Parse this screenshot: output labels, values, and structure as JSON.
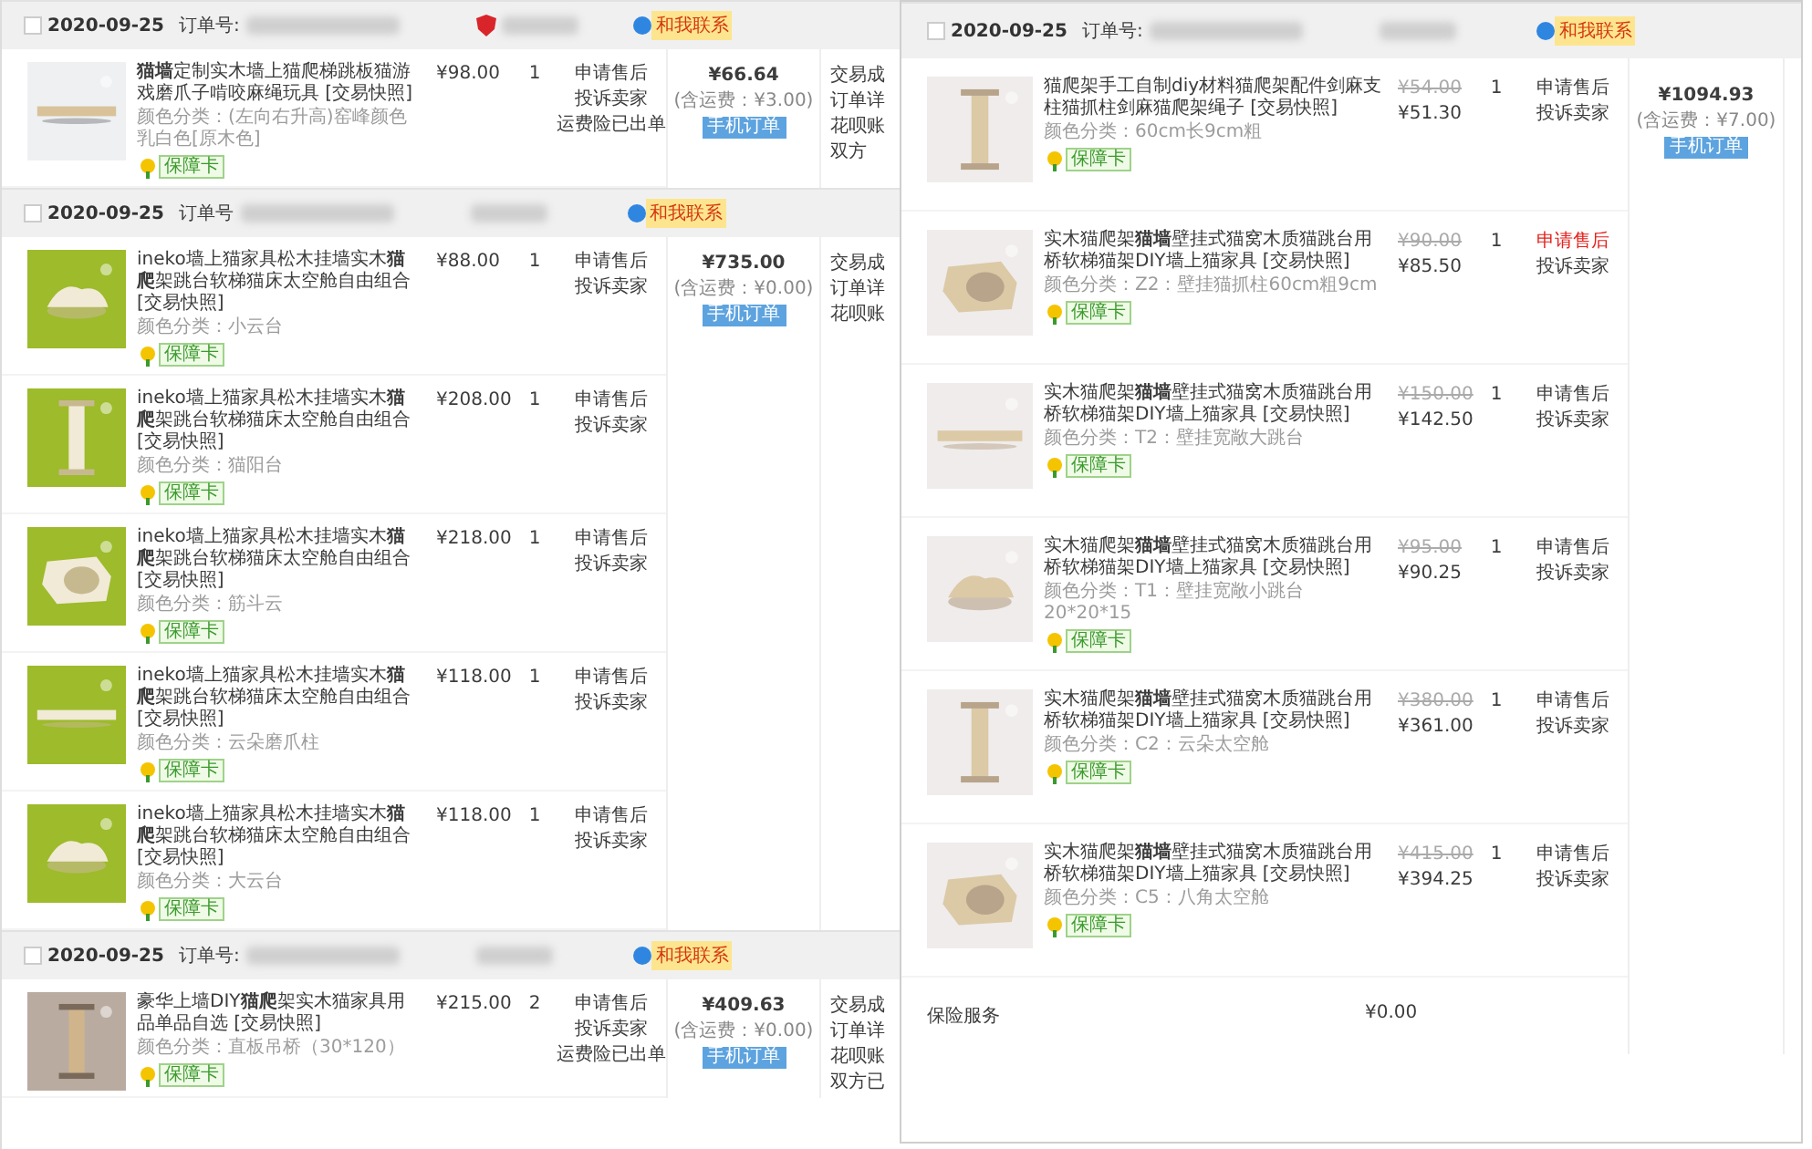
{
  "left_panel": {
    "orders": [
      {
        "checked": false,
        "date": "2020-09-25",
        "order_label": "订单号:",
        "shield_icon": true,
        "contact_badge": "和我联系",
        "total": "¥66.64",
        "shipping_note": "(含运费：¥3.00)",
        "mobile_badge": "手机订单",
        "status_lines": [
          "交易成",
          "订单详",
          "花呗账",
          "双方"
        ],
        "items": [
          {
            "kind": "picture",
            "title": "**猫墙**定制实木墙上猫爬梯跳板猫游戏磨爪子啃咬麻绳玩具 [交易快照]",
            "variant": "颜色分类：(左向右升高)窑峰颜色乳白色[原木色]",
            "badge": "保障卡",
            "price": "¥98.00",
            "quantity": "1",
            "actions": [
              {
                "label": "申请售后",
                "alert": false
              },
              {
                "label": "投诉卖家",
                "alert": false
              },
              {
                "label": "运费险已出单",
                "alert": false
              }
            ]
          }
        ]
      },
      {
        "checked": false,
        "date": "2020-09-25",
        "order_label": "订单号",
        "shield_icon": false,
        "contact_badge": "和我联系",
        "total": "¥735.00",
        "shipping_note": "(含运费：¥0.00)",
        "mobile_badge": "手机订单",
        "status_lines": [
          "交易成",
          "订单详",
          "花呗账"
        ],
        "items": [
          {
            "kind": "picture",
            "title": "ineko墙上猫家具松木挂墙实木**猫爬**架跳台软梯猫床太空舱自由组合 [交易快照]",
            "variant": "颜色分类：小云台",
            "badge": "保障卡",
            "price": "¥88.00",
            "quantity": "1",
            "actions": [
              {
                "label": "申请售后",
                "alert": false
              },
              {
                "label": "投诉卖家",
                "alert": false
              }
            ]
          },
          {
            "kind": "picture",
            "title": "ineko墙上猫家具松木挂墙实木**猫爬**架跳台软梯猫床太空舱自由组合 [交易快照]",
            "variant": "颜色分类：猫阳台",
            "badge": "保障卡",
            "price": "¥208.00",
            "quantity": "1",
            "actions": [
              {
                "label": "申请售后",
                "alert": false
              },
              {
                "label": "投诉卖家",
                "alert": false
              }
            ]
          },
          {
            "kind": "picture",
            "title": "ineko墙上猫家具松木挂墙实木**猫爬**架跳台软梯猫床太空舱自由组合 [交易快照]",
            "variant": "颜色分类：筋斗云",
            "badge": "保障卡",
            "price": "¥218.00",
            "quantity": "1",
            "actions": [
              {
                "label": "申请售后",
                "alert": false
              },
              {
                "label": "投诉卖家",
                "alert": false
              }
            ]
          },
          {
            "kind": "picture",
            "title": "ineko墙上猫家具松木挂墙实木**猫爬**架跳台软梯猫床太空舱自由组合 [交易快照]",
            "variant": "颜色分类：云朵磨爪柱",
            "badge": "保障卡",
            "price": "¥118.00",
            "quantity": "1",
            "actions": [
              {
                "label": "申请售后",
                "alert": false
              },
              {
                "label": "投诉卖家",
                "alert": false
              }
            ]
          },
          {
            "kind": "picture",
            "title": "ineko墙上猫家具松木挂墙实木**猫爬**架跳台软梯猫床太空舱自由组合 [交易快照]",
            "variant": "颜色分类：大云台",
            "badge": "保障卡",
            "price": "¥118.00",
            "quantity": "1",
            "actions": [
              {
                "label": "申请售后",
                "alert": false
              },
              {
                "label": "投诉卖家",
                "alert": false
              }
            ]
          }
        ]
      },
      {
        "checked": false,
        "date": "2020-09-25",
        "order_label": "订单号:",
        "shield_icon": false,
        "contact_badge": "和我联系",
        "total": "¥409.63",
        "shipping_note": "(含运费：¥0.00)",
        "mobile_badge": "手机订单",
        "status_lines": [
          "交易成",
          "订单详",
          "花呗账",
          "双方已"
        ],
        "items": [
          {
            "kind": "picture",
            "title": "豪华上墙DIY**猫爬**架实木猫家具用品单品自选 [交易快照]",
            "variant": "颜色分类：直板吊桥（30*120）",
            "badge": "保障卡",
            "price": "¥215.00",
            "quantity": "2",
            "actions": [
              {
                "label": "申请售后",
                "alert": false
              },
              {
                "label": "投诉卖家",
                "alert": false
              },
              {
                "label": "运费险已出单",
                "alert": false
              }
            ]
          }
        ]
      }
    ]
  },
  "right_panel": {
    "orders": [
      {
        "checked": false,
        "date": "2020-09-25",
        "order_label": "订单号:",
        "shield_icon": false,
        "contact_badge": "和我联系",
        "total": "¥1094.93",
        "shipping_note": "(含运费：¥7.00)",
        "mobile_badge": "手机订单",
        "items": [
          {
            "kind": "picture",
            "title": "猫爬架手工自制diy材料猫爬架配件剑麻支柱猫抓柱剑麻猫爬架绳子 [交易快照]",
            "variant": "颜色分类：60cm长9cm粗",
            "badge": "保障卡",
            "original_price": "¥54.00",
            "price": "¥51.30",
            "quantity": "1",
            "actions": [
              {
                "label": "申请售后",
                "alert": false
              },
              {
                "label": "投诉卖家",
                "alert": false
              }
            ]
          },
          {
            "kind": "picture",
            "title": "实木猫爬架**猫墙**壁挂式猫窝木质猫跳台用桥软梯猫架DIY墙上猫家具 [交易快照]",
            "variant": "颜色分类：Z2：壁挂猫抓柱60cm粗9cm",
            "badge": "保障卡",
            "original_price": "¥90.00",
            "price": "¥85.50",
            "quantity": "1",
            "actions": [
              {
                "label": "申请售后",
                "alert": true
              },
              {
                "label": "投诉卖家",
                "alert": false
              }
            ]
          },
          {
            "kind": "picture",
            "title": "实木猫爬架**猫墙**壁挂式猫窝木质猫跳台用桥软梯猫架DIY墙上猫家具 [交易快照]",
            "variant": "颜色分类：T2：壁挂宽敞大跳台",
            "badge": "保障卡",
            "original_price": "¥150.00",
            "price": "¥142.50",
            "quantity": "1",
            "actions": [
              {
                "label": "申请售后",
                "alert": false
              },
              {
                "label": "投诉卖家",
                "alert": false
              }
            ]
          },
          {
            "kind": "picture",
            "title": "实木猫爬架**猫墙**壁挂式猫窝木质猫跳台用桥软梯猫架DIY墙上猫家具 [交易快照]",
            "variant": "颜色分类：T1：壁挂宽敞小跳台20*20*15",
            "badge": "保障卡",
            "original_price": "¥95.00",
            "price": "¥90.25",
            "quantity": "1",
            "actions": [
              {
                "label": "申请售后",
                "alert": false
              },
              {
                "label": "投诉卖家",
                "alert": false
              }
            ]
          },
          {
            "kind": "picture",
            "title": "实木猫爬架**猫墙**壁挂式猫窝木质猫跳台用桥软梯猫架DIY墙上猫家具 [交易快照]",
            "variant": "颜色分类：C2：云朵太空舱",
            "badge": "保障卡",
            "original_price": "¥380.00",
            "price": "¥361.00",
            "quantity": "1",
            "actions": [
              {
                "label": "申请售后",
                "alert": false
              },
              {
                "label": "投诉卖家",
                "alert": false
              }
            ]
          },
          {
            "kind": "picture",
            "title": "实木猫爬架**猫墙**壁挂式猫窝木质猫跳台用桥软梯猫架DIY墙上猫家具 [交易快照]",
            "variant": "颜色分类：C5：八角太空舱",
            "badge": "保障卡",
            "original_price": "¥415.00",
            "price": "¥394.25",
            "quantity": "1",
            "actions": [
              {
                "label": "申请售后",
                "alert": false
              },
              {
                "label": "投诉卖家",
                "alert": false
              }
            ]
          }
        ],
        "insurance": {
          "label": "保险服务",
          "price": "¥0.00"
        }
      }
    ]
  }
}
